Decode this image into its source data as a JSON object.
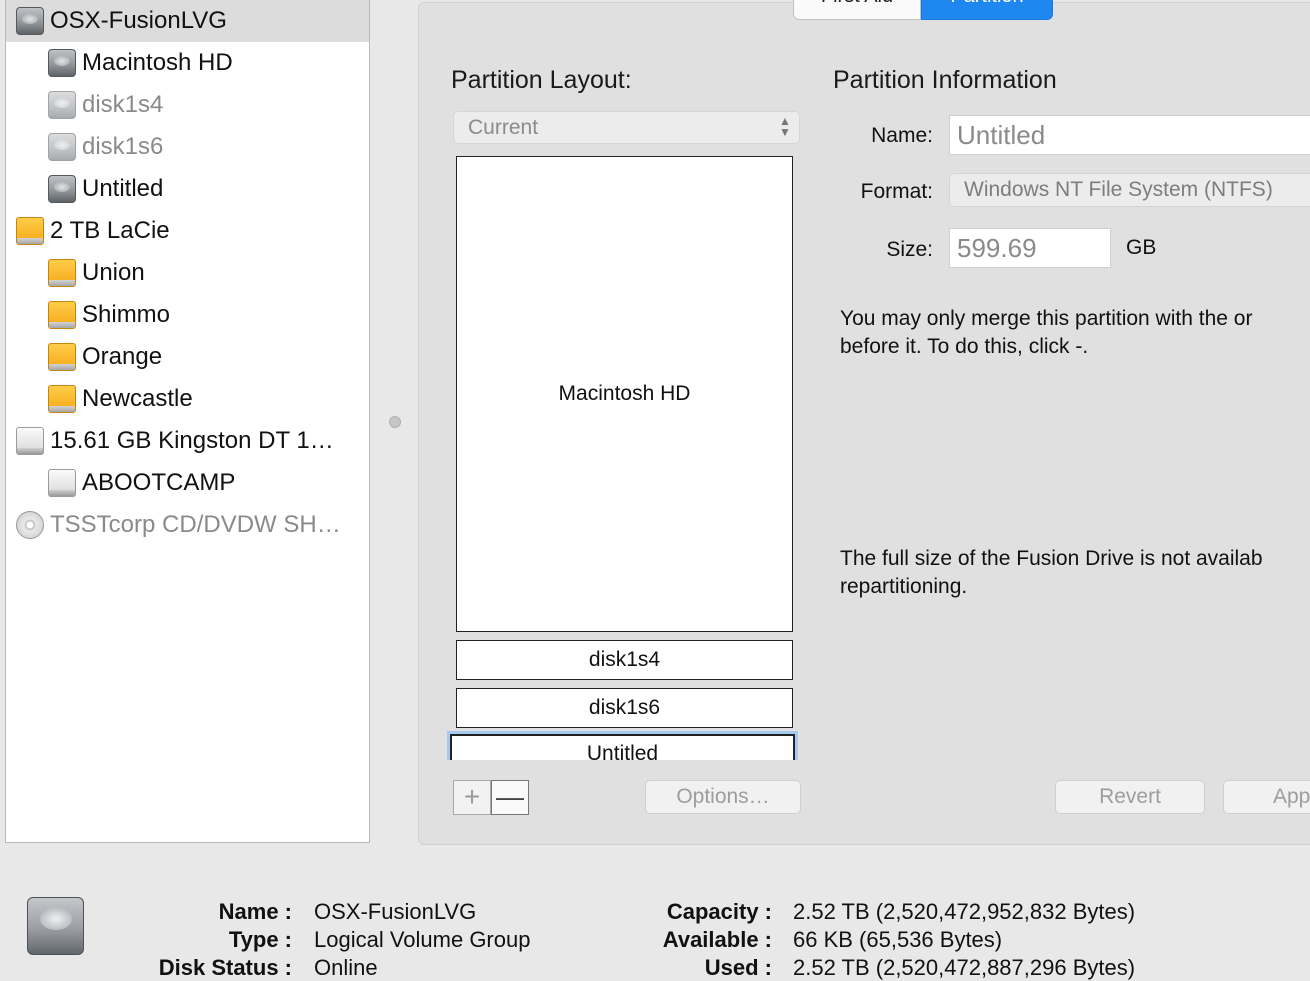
{
  "sidebar": {
    "items": [
      {
        "label": "OSX-FusionLVG",
        "icon": "hard-drive-icon",
        "selected": true,
        "dim": false
      },
      {
        "label": "Macintosh HD",
        "icon": "hard-drive-icon",
        "selected": false,
        "dim": false
      },
      {
        "label": "disk1s4",
        "icon": "hard-drive-icon",
        "selected": false,
        "dim": true
      },
      {
        "label": "disk1s6",
        "icon": "hard-drive-icon",
        "selected": false,
        "dim": true
      },
      {
        "label": "Untitled",
        "icon": "hard-drive-icon",
        "selected": false,
        "dim": false
      },
      {
        "label": "2 TB LaCie",
        "icon": "external-drive-icon",
        "selected": false,
        "dim": false
      },
      {
        "label": "Union",
        "icon": "external-drive-icon",
        "selected": false,
        "dim": false
      },
      {
        "label": "Shimmo",
        "icon": "external-drive-icon",
        "selected": false,
        "dim": false
      },
      {
        "label": "Orange",
        "icon": "external-drive-icon",
        "selected": false,
        "dim": false
      },
      {
        "label": "Newcastle",
        "icon": "external-drive-icon",
        "selected": false,
        "dim": false
      },
      {
        "label": "15.61 GB Kingston DT 1…",
        "icon": "usb-drive-icon",
        "selected": false,
        "dim": false
      },
      {
        "label": "ABOOTCAMP",
        "icon": "usb-drive-icon",
        "selected": false,
        "dim": false
      },
      {
        "label": "TSSTcorp CD/DVDW SH…",
        "icon": "optical-disc-icon",
        "selected": false,
        "dim": true
      }
    ]
  },
  "tabs": {
    "first_aid": "First Aid",
    "partition": "Partition"
  },
  "layout": {
    "heading": "Partition Layout:",
    "select_value": "Current",
    "partitions": [
      "Macintosh HD",
      "disk1s4",
      "disk1s6",
      "Untitled"
    ],
    "options_button": "Options…"
  },
  "info": {
    "heading": "Partition Information",
    "name_label": "Name:",
    "name_value": "Untitled",
    "format_label": "Format:",
    "format_value": "Windows NT File System (NTFS)",
    "size_label": "Size:",
    "size_value": "599.69",
    "size_unit": "GB",
    "merge_note": "You may only merge this partition with the or\nbefore it. To do this, click -.",
    "fusion_note": "The full size of the Fusion Drive is not availab\nrepartitioning.",
    "revert_button": "Revert",
    "apply_button": "App"
  },
  "footer": {
    "name_key": "Name :",
    "name_val": "OSX-FusionLVG",
    "type_key": "Type :",
    "type_val": "Logical Volume Group",
    "status_key": "Disk Status :",
    "status_val": "Online",
    "capacity_key": "Capacity :",
    "capacity_val": "2.52 TB (2,520,472,952,832 Bytes)",
    "available_key": "Available :",
    "available_val": "66 KB (65,536 Bytes)",
    "used_key": "Used :",
    "used_val": "2.52 TB (2,520,472,887,296 Bytes)"
  },
  "colors": {
    "accent": "#1e87f0",
    "selection": "#dcdcdc"
  }
}
